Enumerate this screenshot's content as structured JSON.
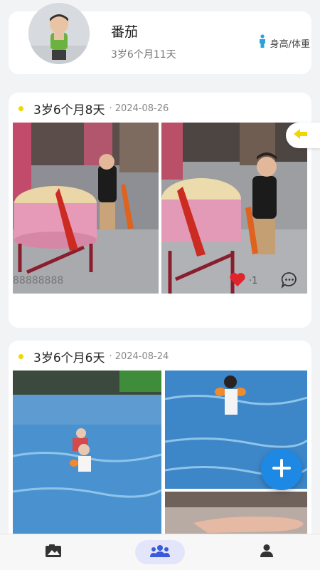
{
  "profile": {
    "name": "番茄",
    "age": "3岁6个月11天",
    "growth_label": "身高/体重"
  },
  "posts": [
    {
      "age": "3岁6个月8天",
      "date": "· 2024-08-26",
      "caption": "88888888",
      "likes": "·1"
    },
    {
      "age": "3岁6个月6天",
      "date": "· 2024-08-24"
    }
  ],
  "icons": {
    "growth": "person-icon",
    "like": "heart-icon",
    "comment": "comment-icon",
    "side_tab": "arrow-left-icon",
    "fab": "plus-icon",
    "nav": [
      "photo-album-icon",
      "family-icon",
      "profile-icon"
    ]
  },
  "colors": {
    "accent": "#1e88e5",
    "dot": "#f1d600",
    "heart": "#e0242b",
    "nav_active_bg": "#e3e6fb",
    "nav_active_icon": "#3b5bdb"
  },
  "bottom_nav": {
    "active_index": 1
  }
}
